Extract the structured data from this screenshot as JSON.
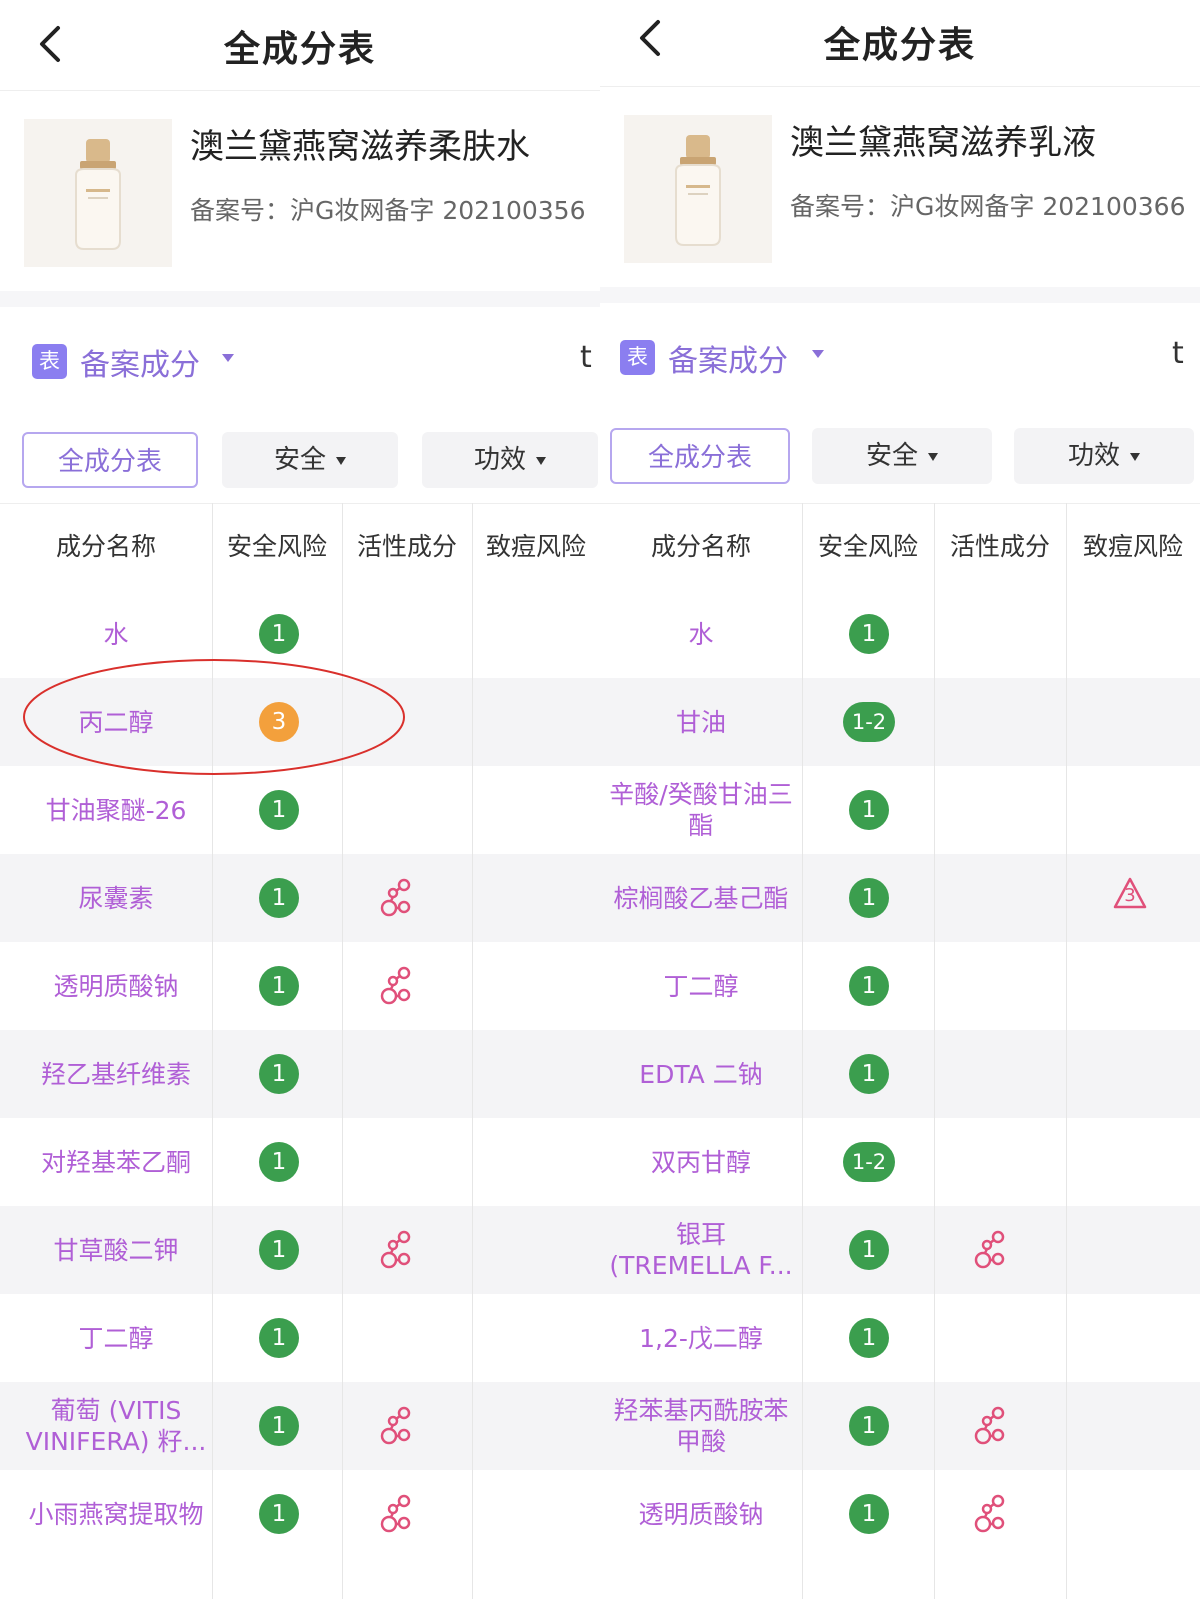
{
  "left": {
    "title": "全成分表",
    "product_name": "澳兰黛燕窝滋养柔肤水",
    "registration": "备案号：沪G妆网备字 202100356",
    "section_icon_label": "表",
    "section_label": "备案成分",
    "section_cut": "t",
    "filters": [
      {
        "label": "全成分表"
      },
      {
        "label": "安全"
      },
      {
        "label": "功效"
      }
    ],
    "columns": [
      "成分名称",
      "安全风险",
      "活性成分",
      "致痘风险"
    ],
    "rows": [
      {
        "name": "水",
        "risk": "1",
        "active": false
      },
      {
        "name": "丙二醇",
        "risk": "3",
        "active": false,
        "highlight": true
      },
      {
        "name": "甘油聚醚-26",
        "risk": "1",
        "active": false
      },
      {
        "name": "尿囊素",
        "risk": "1",
        "active": true
      },
      {
        "name": "透明质酸钠",
        "risk": "1",
        "active": true
      },
      {
        "name": "羟乙基纤维素",
        "risk": "1",
        "active": false
      },
      {
        "name": "对羟基苯乙酮",
        "risk": "1",
        "active": false
      },
      {
        "name": "甘草酸二钾",
        "risk": "1",
        "active": true
      },
      {
        "name": "丁二醇",
        "risk": "1",
        "active": false
      },
      {
        "name": "葡萄 (VITIS VINIFERA) 籽...",
        "risk": "1",
        "active": true
      },
      {
        "name": "小雨燕窝提取物",
        "risk": "1",
        "active": true
      }
    ]
  },
  "right": {
    "title": "全成分表",
    "product_name": "澳兰黛燕窝滋养乳液",
    "registration": "备案号：沪G妆网备字 202100366",
    "section_icon_label": "表",
    "section_label": "备案成分",
    "section_cut": "t",
    "filters": [
      {
        "label": "全成分表"
      },
      {
        "label": "安全"
      },
      {
        "label": "功效"
      }
    ],
    "columns": [
      "成分名称",
      "安全风险",
      "活性成分",
      "致痘风险"
    ],
    "rows": [
      {
        "name": "水",
        "risk": "1",
        "active": false
      },
      {
        "name": "甘油",
        "risk": "1-2",
        "active": false
      },
      {
        "name": "辛酸/癸酸甘油三酯",
        "risk": "1",
        "active": false
      },
      {
        "name": "棕榈酸乙基己酯",
        "risk": "1",
        "active": false,
        "acne": "3"
      },
      {
        "name": "丁二醇",
        "risk": "1",
        "active": false
      },
      {
        "name": "EDTA 二钠",
        "risk": "1",
        "active": false
      },
      {
        "name": "双丙甘醇",
        "risk": "1-2",
        "active": false
      },
      {
        "name": "银耳 (TREMELLA F...",
        "risk": "1",
        "active": true
      },
      {
        "name": "1,2-戊二醇",
        "risk": "1",
        "active": false
      },
      {
        "name": "羟苯基丙酰胺苯甲酸",
        "risk": "1",
        "active": true
      },
      {
        "name": "透明质酸钠",
        "risk": "1",
        "active": true
      }
    ]
  },
  "colors": {
    "accent_purple": "#8a6fd8",
    "ingredient_text": "#b05fd6",
    "risk_green": "#3b9e4e",
    "risk_orange": "#f3a03c",
    "active_icon": "#e0507a",
    "highlight_ellipse": "#d9302c"
  },
  "icons": {
    "back": "chevron-left-icon",
    "section": "table-icon",
    "active": "molecule-icon",
    "acne": "warning-triangle-icon"
  }
}
